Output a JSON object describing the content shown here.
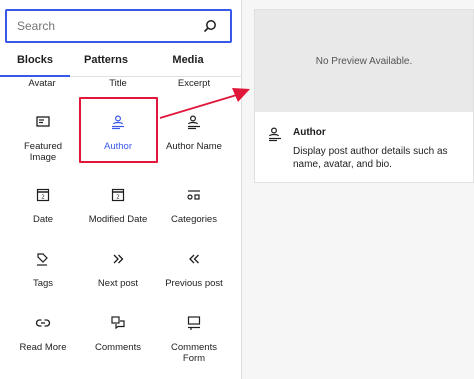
{
  "search": {
    "placeholder": "Search"
  },
  "tabs": [
    {
      "label": "Blocks",
      "active": true
    },
    {
      "label": "Patterns",
      "active": false
    },
    {
      "label": "Media",
      "active": false
    }
  ],
  "blocks": {
    "row0": [
      "Avatar",
      "Title",
      "Excerpt"
    ],
    "featured_image": "Featured\nImage",
    "author": "Author",
    "author_name": "Author Name",
    "date": "Date",
    "modified_date": "Modified Date",
    "categories": "Categories",
    "tags": "Tags",
    "next_post": "Next post",
    "previous_post": "Previous post",
    "read_more": "Read More",
    "comments": "Comments",
    "comments_form": "Comments\nForm"
  },
  "preview": {
    "empty_text": "No Preview Available.",
    "title": "Author",
    "description": "Display post author details such as name, avatar, and bio."
  },
  "colors": {
    "accent": "#3858e9",
    "highlight": "#e0173a"
  }
}
